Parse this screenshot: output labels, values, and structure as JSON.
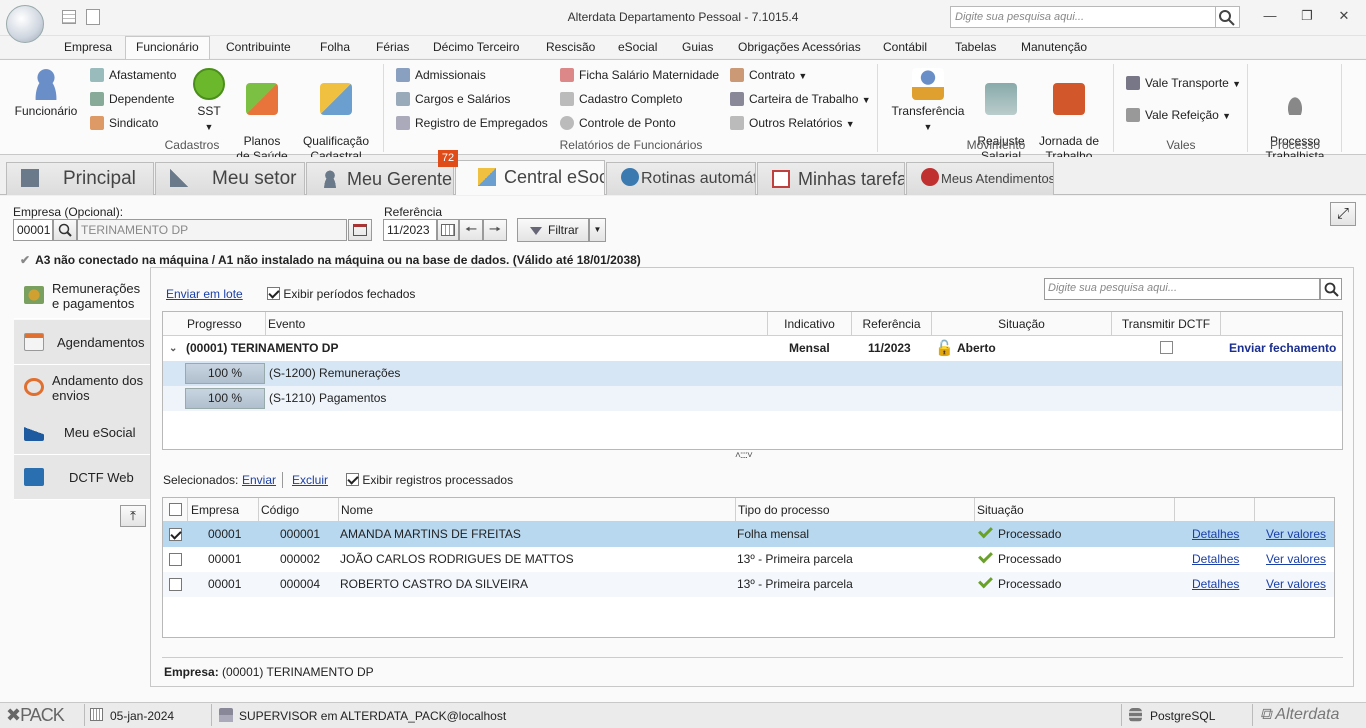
{
  "app": {
    "title": "Alterdata Departamento Pessoal - 7.1015.4",
    "search_placeholder": "Digite sua pesquisa aqui..."
  },
  "menu": [
    "Empresa",
    "Funcionário",
    "Contribuinte",
    "Folha",
    "Férias",
    "Décimo Terceiro",
    "Rescisão",
    "eSocial",
    "Guias",
    "Obrigações Acessórias",
    "Contábil",
    "Tabelas",
    "Manutenção"
  ],
  "ribbon": {
    "funcionario": "Funcionário",
    "afastamento": "Afastamento",
    "dependente": "Dependente",
    "sindicato": "Sindicato",
    "sst": "SST",
    "planos": "Planos\nde Saúde",
    "qualificacao": "Qualificação\nCadastral",
    "cadastros_label": "Cadastros",
    "admissionais": "Admissionais",
    "cargos": "Cargos e Salários",
    "registro": "Registro de Empregados",
    "ficha": "Ficha Salário Maternidade",
    "cadastro_completo": "Cadastro Completo",
    "controle_ponto": "Controle de Ponto",
    "contrato": "Contrato",
    "carteira": "Carteira de Trabalho",
    "outros": "Outros Relatórios",
    "relatorios_label": "Relatórios de Funcionários",
    "transferencia": "Transferência",
    "reajuste": "Reajuste\nSalarial",
    "jornada": "Jornada de\nTrabalho",
    "movimento_label": "Movimento",
    "vale_transporte": "Vale Transporte",
    "vale_refeicao": "Vale Refeição",
    "vales_label": "Vales",
    "processo": "Processo\nTrabalhista",
    "processo_label": "Processo"
  },
  "tabs": [
    "Principal",
    "Meu setor",
    "Meu Gerente",
    "Central eSocial",
    "Rotinas automáticas",
    "Minhas tarefas",
    "Meus Atendimentos"
  ],
  "badge": "72",
  "filters": {
    "empresa_label": "Empresa (Opcional):",
    "empresa_code": "00001",
    "empresa_name": "TERINAMENTO DP",
    "referencia_label": "Referência",
    "referencia": "11/2023",
    "filtrar": "Filtrar"
  },
  "cert_warning": "A3 não conectado na máquina / A1 não instalado na máquina ou na base de dados. (Válido até 18/01/2038)",
  "sidenav": [
    "Remunerações e pagamentos",
    "Agendamentos",
    "Andamento dos envios",
    "Meu eSocial",
    "DCTF Web"
  ],
  "top_section": {
    "enviar_lote": "Enviar em lote",
    "exibir_fechados": "Exibir períodos fechados",
    "search_placeholder": "Digite sua pesquisa aqui...",
    "headers": [
      "Progresso",
      "Evento",
      "Indicativo",
      "Referência",
      "Situação",
      "Transmitir DCTF"
    ],
    "group": {
      "label": "(00001) TERINAMENTO DP",
      "indicativo": "Mensal",
      "referencia": "11/2023",
      "situacao": "Aberto",
      "action": "Enviar fechamento"
    },
    "rows": [
      {
        "progress": "100 %",
        "evento": "(S-1200) Remunerações"
      },
      {
        "progress": "100 %",
        "evento": "(S-1210) Pagamentos"
      }
    ]
  },
  "bottom_section": {
    "selecionados": "Selecionados:",
    "enviar": "Enviar",
    "excluir": "Excluir",
    "exibir_processados": "Exibir registros processados",
    "headers": [
      "Empresa",
      "Código",
      "Nome",
      "Tipo do processo",
      "Situação"
    ],
    "rows": [
      {
        "checked": true,
        "empresa": "00001",
        "codigo": "000001",
        "nome": "AMANDA MARTINS DE FREITAS",
        "tipo": "Folha mensal",
        "situacao": "Processado",
        "detalhes": "Detalhes",
        "ver": "Ver valores"
      },
      {
        "checked": false,
        "empresa": "00001",
        "codigo": "000002",
        "nome": "JOÃO CARLOS RODRIGUES DE MATTOS",
        "tipo": "13º - Primeira parcela",
        "situacao": "Processado",
        "detalhes": "Detalhes",
        "ver": "Ver valores"
      },
      {
        "checked": false,
        "empresa": "00001",
        "codigo": "000004",
        "nome": "ROBERTO CASTRO DA SILVEIRA",
        "tipo": "13º - Primeira parcela",
        "situacao": "Processado",
        "detalhes": "Detalhes",
        "ver": "Ver valores"
      }
    ],
    "footer_label": "Empresa:",
    "footer_value": "(00001) TERINAMENTO DP"
  },
  "status": {
    "pack": "PACK",
    "date": "05-jan-2024",
    "user": "SUPERVISOR em ALTERDATA_PACK@localhost",
    "db": "PostgreSQL",
    "brand": "Alterdata"
  }
}
